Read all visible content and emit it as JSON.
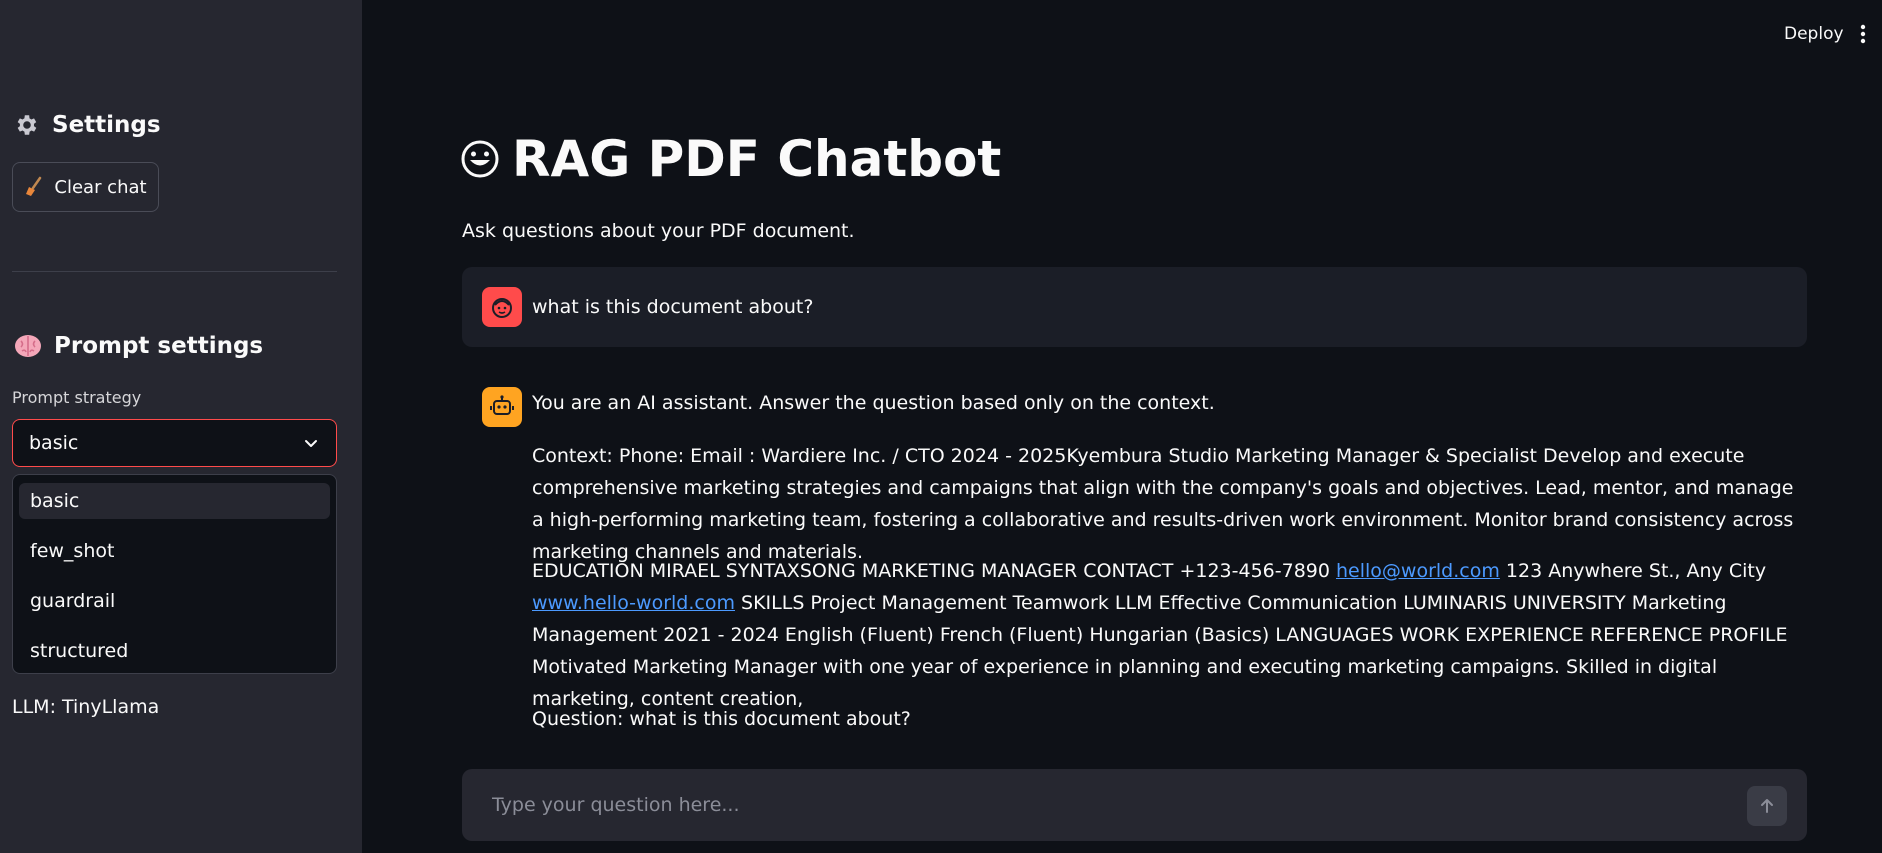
{
  "sidebar": {
    "settings_heading": "Settings",
    "clear_button_label": "Clear chat",
    "prompt_heading": "Prompt settings",
    "prompt_strategy_label": "Prompt strategy",
    "prompt_strategy_selected": "basic",
    "prompt_strategy_options": [
      "basic",
      "few_shot",
      "guardrail",
      "structured"
    ],
    "llm_label": "LLM: TinyLlama"
  },
  "header": {
    "deploy_label": "Deploy"
  },
  "main": {
    "title": "RAG PDF Chatbot",
    "subtitle": "Ask questions about your PDF document.",
    "user_message": "what is this document about?",
    "assistant": {
      "line1": "You are an AI assistant. Answer the question based only on the context.",
      "context": "Context: Phone: Email : Wardiere Inc. / CTO 2024 - 2025Kyembura Studio Marketing Manager & Specialist Develop and execute comprehensive marketing strategies and campaigns that align with the company's goals and objectives. Lead, mentor, and manage a high-performing marketing team, fostering a collaborative and results-driven work environment. Monitor brand consistency across marketing channels and materials.",
      "education_part1": "EDUCATION MIRAEL SYNTAXSONG MARKETING MANAGER CONTACT +123-456-7890 ",
      "email_link": "hello@world.com",
      "education_part2": " 123 Anywhere St., Any City ",
      "website_link": "www.hello-world.com",
      "education_part3": " SKILLS Project Management Teamwork LLM Effective Communication LUMINARIS UNIVERSITY Marketing Management 2021 - 2024 English (Fluent) French (Fluent) Hungarian (Basics) LANGUAGES WORK EXPERIENCE REFERENCE PROFILE Motivated Marketing Manager with one year of experience in planning and executing marketing campaigns. Skilled in digital marketing, content creation,",
      "question": "Question: what is this document about?"
    },
    "chat_input_placeholder": "Type your question here..."
  },
  "colors": {
    "primary": "#ff4b4b",
    "assistant_avatar": "#ffa421",
    "link": "#4c9aff",
    "background": "#0e1117",
    "sidebar_bg": "#262730"
  },
  "icons": {
    "settings": "gear-icon",
    "clear": "broom-icon",
    "prompt": "brain-icon",
    "title": "grinning-face-icon",
    "user_avatar": "user-face-icon",
    "bot_avatar": "robot-icon",
    "send": "arrow-up-icon",
    "menu": "kebab-menu-icon"
  }
}
